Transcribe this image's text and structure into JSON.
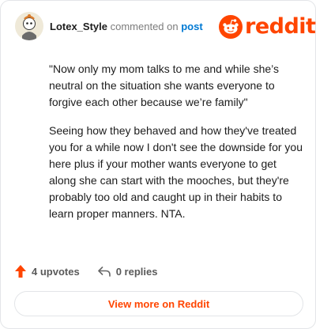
{
  "header": {
    "username": "Lotex_Style",
    "action_text": "commented on",
    "post_link": "post"
  },
  "brand": {
    "wordmark": "reddit",
    "color": "#ff4500"
  },
  "comment": {
    "paragraphs": [
      "\"Now only my mom talks to me and while she’s neutral on the situation she wants everyone to forgive each other because we’re family\"",
      "Seeing how they behaved and how they've treated you for a while now I don't see the downside for you here plus if your mother wants everyone to get along she can start with the mooches, but they're probably too old and caught up in their habits to learn proper manners. NTA."
    ]
  },
  "actions": {
    "upvotes": "4 upvotes",
    "replies": "0 replies"
  },
  "footer": {
    "view_more": "View more on Reddit"
  },
  "colors": {
    "accent": "#ff4500",
    "link": "#0079d3",
    "text": "#1c1c1c",
    "muted": "#7c7c7c"
  },
  "icons": [
    "avatar",
    "reddit-snoo-icon",
    "upvote-arrow-icon",
    "reply-icon"
  ]
}
